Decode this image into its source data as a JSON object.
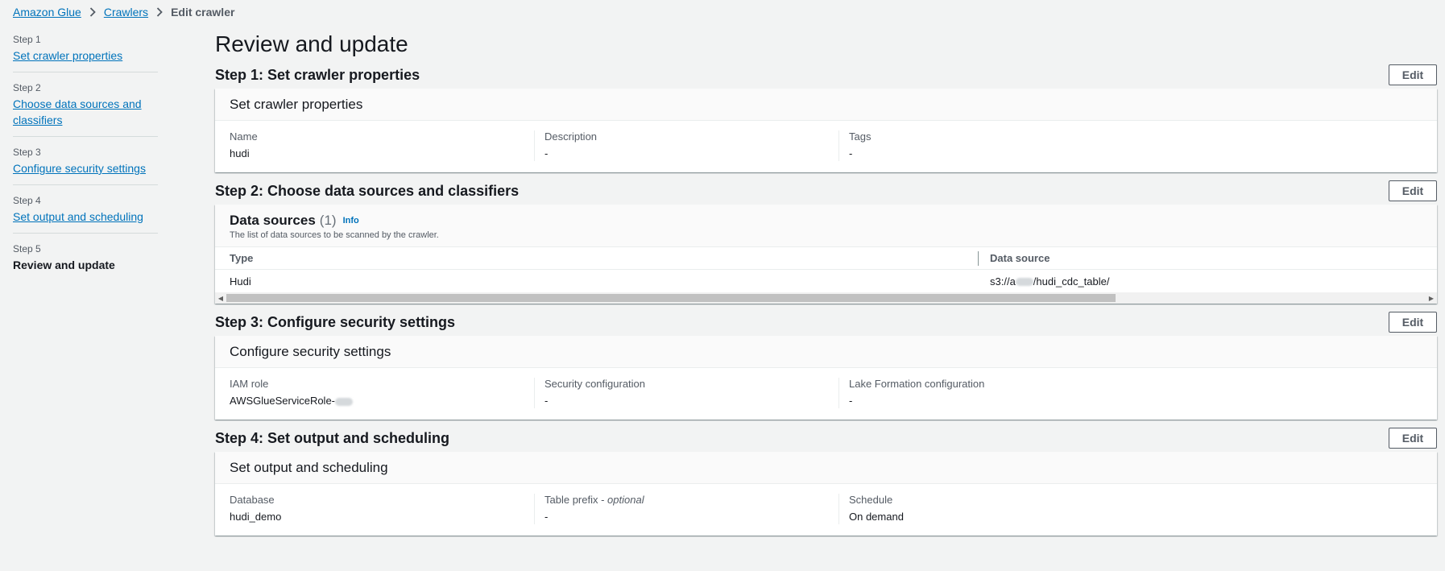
{
  "breadcrumb": {
    "items": [
      "Amazon Glue",
      "Crawlers"
    ],
    "current": "Edit crawler"
  },
  "steps": [
    {
      "num": "Step 1",
      "label": "Set crawler properties"
    },
    {
      "num": "Step 2",
      "label": "Choose data sources and classifiers"
    },
    {
      "num": "Step 3",
      "label": "Configure security settings"
    },
    {
      "num": "Step 4",
      "label": "Set output and scheduling"
    },
    {
      "num": "Step 5",
      "label": "Review and update"
    }
  ],
  "page_title": "Review and update",
  "edit_label": "Edit",
  "section1": {
    "title": "Step 1: Set crawler properties",
    "card_title": "Set crawler properties",
    "fields": [
      {
        "label": "Name",
        "value": "hudi"
      },
      {
        "label": "Description",
        "value": "-"
      },
      {
        "label": "Tags",
        "value": "-"
      }
    ]
  },
  "section2": {
    "title": "Step 2: Choose data sources and classifiers",
    "card_title": "Data sources",
    "count": "(1)",
    "info": "Info",
    "description": "The list of data sources to be scanned by the crawler.",
    "columns": [
      "Type",
      "Data source"
    ],
    "rows": [
      {
        "type": "Hudi",
        "source_prefix": "s3://a",
        "source_suffix": "/hudi_cdc_table/"
      }
    ]
  },
  "section3": {
    "title": "Step 3: Configure security settings",
    "card_title": "Configure security settings",
    "fields": [
      {
        "label": "IAM role",
        "value": "AWSGlueServiceRole-"
      },
      {
        "label": "Security configuration",
        "value": "-"
      },
      {
        "label": "Lake Formation configuration",
        "value": "-"
      }
    ]
  },
  "section4": {
    "title": "Step 4: Set output and scheduling",
    "card_title": "Set output and scheduling",
    "fields": [
      {
        "label": "Database",
        "value": "hudi_demo"
      },
      {
        "label": "Table prefix - ",
        "label_em": "optional",
        "value": "-"
      },
      {
        "label": "Schedule",
        "value": "On demand"
      }
    ]
  }
}
